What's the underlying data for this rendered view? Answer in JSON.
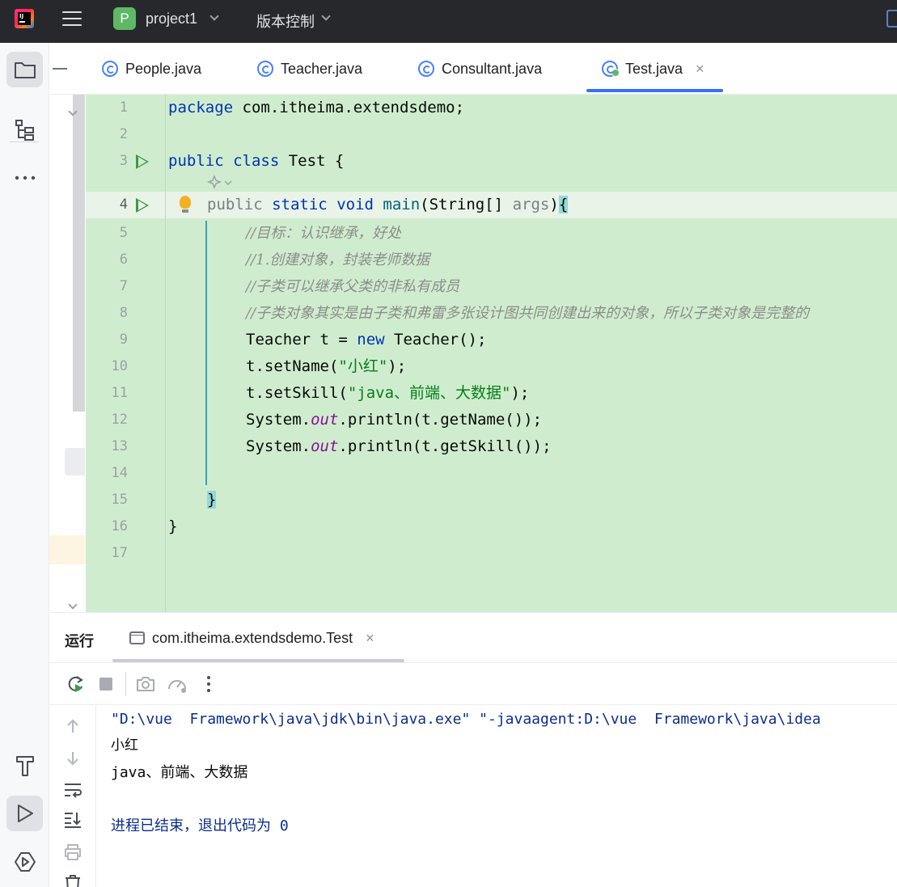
{
  "titlebar": {
    "project_initial": "P",
    "project_name": "project1",
    "vcs_label": "版本控制"
  },
  "tabs": [
    {
      "label": "People.java",
      "active": false
    },
    {
      "label": "Teacher.java",
      "active": false
    },
    {
      "label": "Consultant.java",
      "active": false
    },
    {
      "label": "Test.java",
      "active": true
    }
  ],
  "tab_close_glyph": "×",
  "editor": {
    "line_numbers": [
      "1",
      "2",
      "3",
      "4",
      "5",
      "6",
      "7",
      "8",
      "9",
      "10",
      "11",
      "12",
      "13",
      "14",
      "15",
      "16",
      "17"
    ],
    "lines": {
      "l1_kw": "package",
      "l1_rest": " com.itheima.extendsdemo;",
      "l3_kw1": "public",
      "l3_kw2": "class",
      "l3_rest": " Test {",
      "l4_kw1": "public",
      "l4_kw2": "static",
      "l4_kw3": "void",
      "l4_fn": "main",
      "l4_sig": "(String[] ",
      "l4_param": "args",
      "l4_close": ")",
      "l4_brace": "{",
      "l5": "//目标：认识继承，好处",
      "l6": "//1.创建对象，封装老师数据",
      "l7": "//子类可以继承父类的非私有成员",
      "l8": "//子类对象其实是由子类和弗雷多张设计图共同创建出来的对象，所以子类对象是完整的",
      "l9_a": "Teacher t = ",
      "l9_kw": "new",
      "l9_b": " Teacher();",
      "l10_a": "t.setName(",
      "l10_str": "\"小红\"",
      "l10_b": ");",
      "l11_a": "t.setSkill(",
      "l11_str": "\"java、前端、大数据\"",
      "l11_b": ");",
      "l12_a": "System.",
      "l12_fld": "out",
      "l12_b": ".println(t.getName());",
      "l13_a": "System.",
      "l13_fld": "out",
      "l13_b": ".println(t.getSkill());",
      "l15": "}",
      "l16": "}"
    }
  },
  "run_panel": {
    "title": "运行",
    "tab_label": "com.itheima.extendsdemo.Test",
    "console": [
      "\"D:\\vue  Framework\\java\\jdk\\bin\\java.exe\" \"-javaagent:D:\\vue  Framework\\java\\idea",
      "小红",
      "java、前端、大数据",
      "",
      "进程已结束，退出代码为 0"
    ]
  },
  "colors": {
    "diff_added_bg": "#cfedce",
    "accent": "#3574f0",
    "run_green": "#3d9a44"
  }
}
